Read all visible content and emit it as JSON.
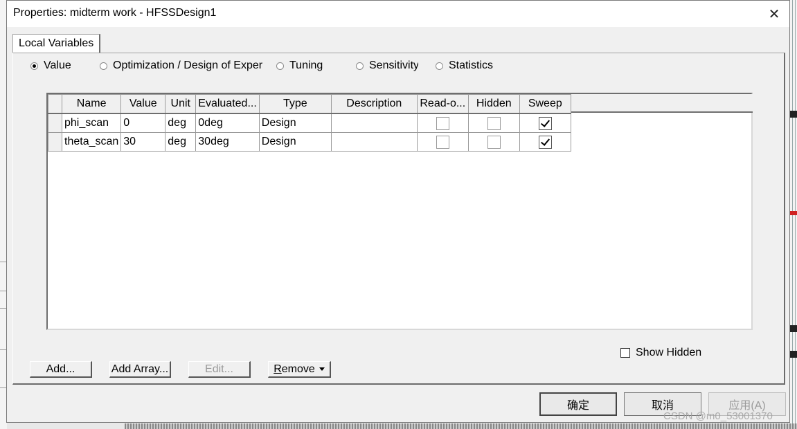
{
  "window": {
    "title": "Properties: midterm work - HFSSDesign1",
    "close_glyph": "✕"
  },
  "tabs": [
    {
      "label": "Local Variables",
      "selected": true
    }
  ],
  "radio_options": [
    {
      "label": "Value",
      "selected": true
    },
    {
      "label": "Optimization / Design of Exper",
      "selected": false
    },
    {
      "label": "Tuning",
      "selected": false
    },
    {
      "label": "Sensitivity",
      "selected": false
    },
    {
      "label": "Statistics",
      "selected": false
    }
  ],
  "table": {
    "columns": [
      "Name",
      "Value",
      "Unit",
      "Evaluated...",
      "Type",
      "Description",
      "Read-o...",
      "Hidden",
      "Sweep"
    ],
    "rows": [
      {
        "name": "phi_scan",
        "value": "0",
        "unit": "deg",
        "evaluated": "0deg",
        "type": "Design",
        "description": "",
        "read_only": false,
        "hidden": false,
        "sweep": true
      },
      {
        "name": "theta_scan",
        "value": "30",
        "unit": "deg",
        "evaluated": "30deg",
        "type": "Design",
        "description": "",
        "read_only": false,
        "hidden": false,
        "sweep": true
      }
    ]
  },
  "show_hidden": {
    "label": "Show Hidden",
    "checked": false
  },
  "buttons": {
    "add": "Add...",
    "add_array": "Add Array...",
    "edit": "Edit...",
    "remove_first": "R",
    "remove_rest": "emove"
  },
  "dialog_buttons": {
    "ok": "确定",
    "cancel": "取消",
    "apply": "应用(A)"
  },
  "watermark": "CSDN @m0_53001370",
  "icons": {
    "close": "close-icon",
    "remove_dropdown": "caret-down-icon",
    "checkmark": "checkmark-icon"
  }
}
